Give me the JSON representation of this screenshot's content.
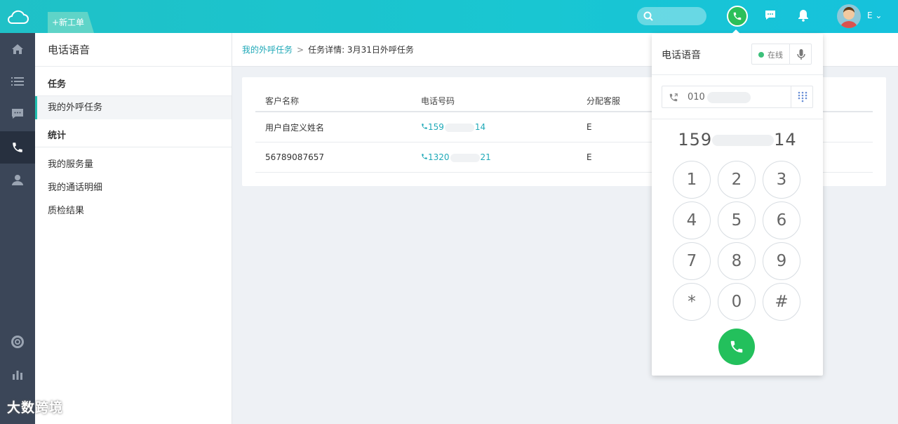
{
  "topbar": {
    "new_ticket": "+新工单",
    "user_initial": "E",
    "user_caret": "⌄"
  },
  "sidebar": {
    "title": "电话语音",
    "sections": [
      {
        "label": "任务",
        "items": [
          "我的外呼任务"
        ]
      },
      {
        "label": "统计",
        "items": [
          "我的服务量",
          "我的通话明细",
          "质检结果"
        ]
      }
    ],
    "active_item": "我的外呼任务"
  },
  "breadcrumb": {
    "link": "我的外呼任务",
    "separator": ">",
    "current": "任务详情: 3月31日外呼任务"
  },
  "table": {
    "headers": [
      "客户名称",
      "电话号码",
      "分配客服"
    ],
    "rows": [
      {
        "name": "用户自定义姓名",
        "phone_prefix": "159",
        "phone_suffix": "14",
        "agent": "E"
      },
      {
        "name": "56789087657",
        "phone_prefix": "1320",
        "phone_suffix": "21",
        "agent": "E"
      }
    ]
  },
  "dialer": {
    "title": "电话语音",
    "status": "在线",
    "input_prefix": "010",
    "number_prefix": "159",
    "number_suffix": "14",
    "keys": [
      "1",
      "2",
      "3",
      "4",
      "5",
      "6",
      "7",
      "8",
      "9",
      "*",
      "0",
      "#"
    ]
  },
  "watermark": "大数跨境",
  "colors": {
    "topbar": "#1fc1c7",
    "rail": "#3b4658",
    "accent": "#20a9b8",
    "call_green": "#23c05c",
    "online": "#3cc07a"
  }
}
